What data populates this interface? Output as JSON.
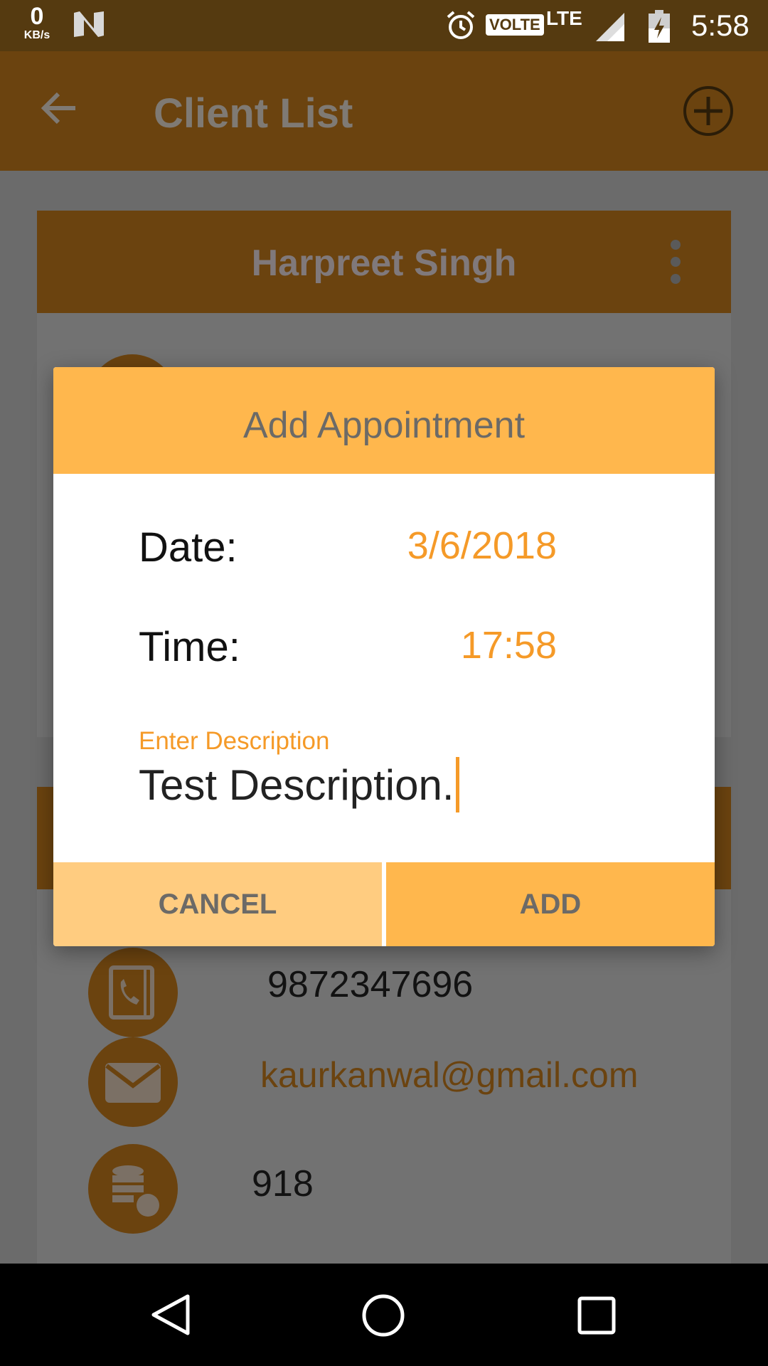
{
  "status_bar": {
    "speed_value": "0",
    "speed_unit": "KB/s",
    "network_badge": "VOLTE",
    "network_type": "LTE",
    "time": "5:58"
  },
  "app_bar": {
    "title": "Client List",
    "back_icon": "arrow-back-icon",
    "add_icon": "add-circle-icon"
  },
  "client_card": {
    "name": "Harpreet Singh",
    "menu_icon": "more-vert-icon"
  },
  "contact_card": {
    "phone": "9872347696",
    "email": "kaurkanwal@gmail.com",
    "count": "918"
  },
  "dialog": {
    "title": "Add Appointment",
    "date_label": "Date:",
    "date_value": "3/6/2018",
    "time_label": "Time:",
    "time_value": "17:58",
    "description_hint": "Enter Description",
    "description_value": "Test Description.",
    "cancel_label": "CANCEL",
    "add_label": "ADD"
  },
  "colors": {
    "accent": "#ffb74d",
    "accent_light": "#ffcc80",
    "value_orange": "#f59a28",
    "dim_brown": "#6b430f"
  }
}
